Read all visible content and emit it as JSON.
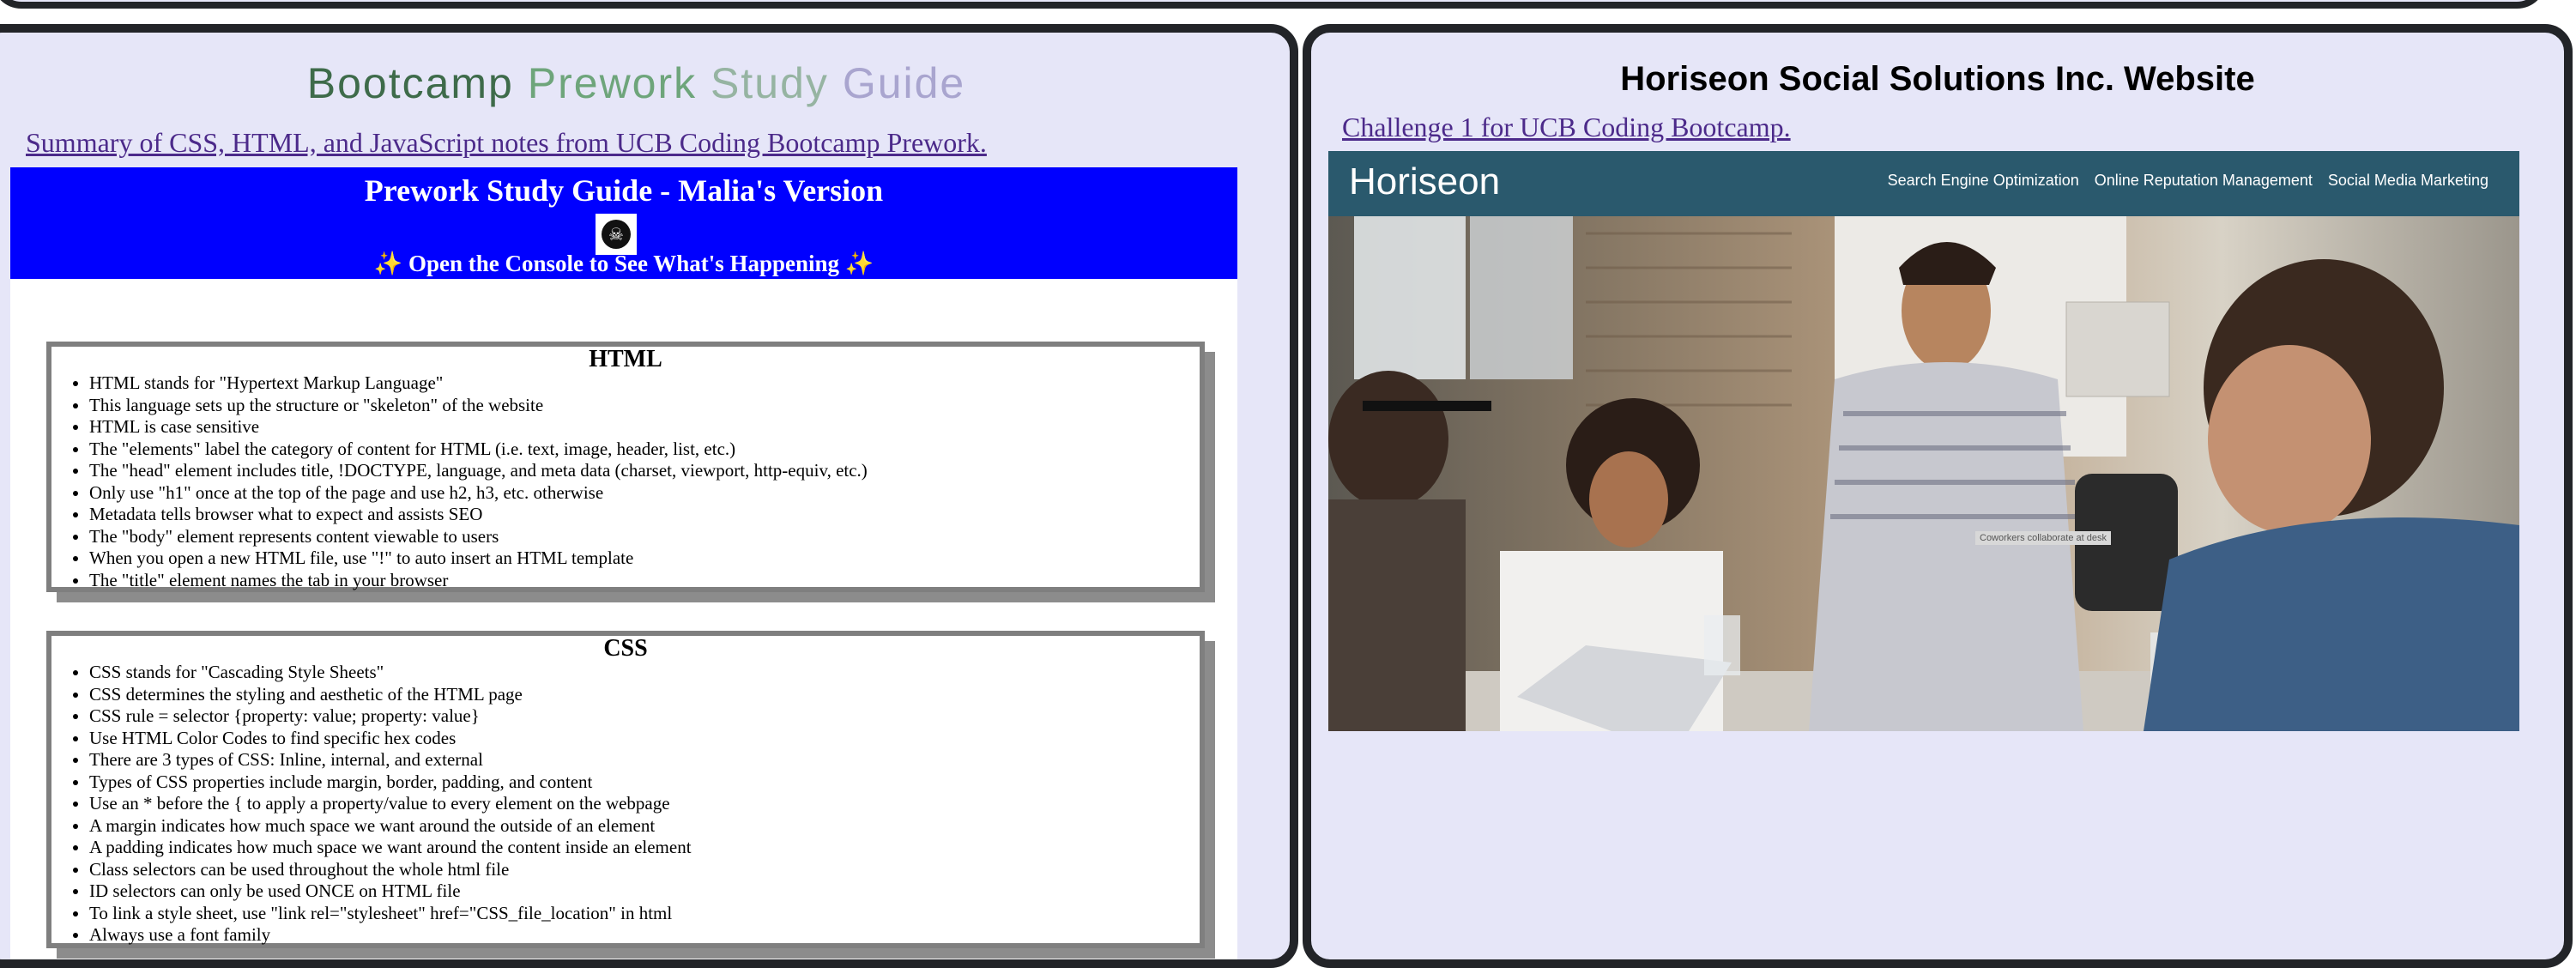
{
  "left_card": {
    "title_words": [
      "Bootcamp",
      "Prework",
      "Study",
      "Guide"
    ],
    "subtitle_link": "Summary of CSS, HTML, and JavaScript notes from UCB Coding Bootcamp Prework.",
    "guide": {
      "header_title": "Prework Study Guide - Malia's Version",
      "logo_glyph": "☠",
      "console_note": "✨ Open the Console to See What's Happening ✨",
      "html_section": {
        "heading": "HTML",
        "items": [
          "HTML stands for \"Hypertext Markup Language\"",
          "This language sets up the structure or \"skeleton\" of the website",
          "HTML is case sensitive",
          "The \"elements\" label the category of content for HTML (i.e. text, image, header, list, etc.)",
          "The \"head\" element includes title, !DOCTYPE, language, and meta data (charset, viewport, http-equiv, etc.)",
          "Only use \"h1\" once at the top of the page and use h2, h3, etc. otherwise",
          "Metadata tells browser what to expect and assists SEO",
          "The \"body\" element represents content viewable to users",
          "When you open a new HTML file, use \"!\" to auto insert an HTML template",
          "The \"title\" element names the tab in your browser"
        ]
      },
      "css_section": {
        "heading": "CSS",
        "items": [
          "CSS stands for \"Cascading Style Sheets\"",
          "CSS determines the styling and aesthetic of the HTML page",
          "CSS rule = selector {property: value; property: value}",
          "Use HTML Color Codes to find specific hex codes",
          "There are 3 types of CSS: Inline, internal, and external",
          "Types of CSS properties include margin, border, padding, and content",
          "Use an * before the { to apply a property/value to every element on the webpage",
          "A margin indicates how much space we want around the outside of an element",
          "A padding indicates how much space we want around the content inside an element",
          "Class selectors can be used throughout the whole html file",
          "ID selectors can only be used ONCE on HTML file",
          "To link a style sheet, use \"link rel=\"stylesheet\" href=\"CSS_file_location\" in html",
          "Always use a font family"
        ]
      }
    }
  },
  "right_card": {
    "title": "Horiseon Social Solutions Inc. Website",
    "subtitle_link": "Challenge 1 for UCB Coding Bootcamp.",
    "site": {
      "logo": "Horiseon",
      "nav": [
        "Search Engine Optimization",
        "Online Reputation Management",
        "Social Media Marketing"
      ],
      "hero_caption": "Coworkers collaborate at desk"
    }
  },
  "colors": {
    "card_background": "#e6e6f8",
    "card_border": "#222428",
    "guide_header_blue": "#0000ff",
    "link_purple": "#4c2a8a",
    "site_nav_teal": "#2a596d"
  }
}
